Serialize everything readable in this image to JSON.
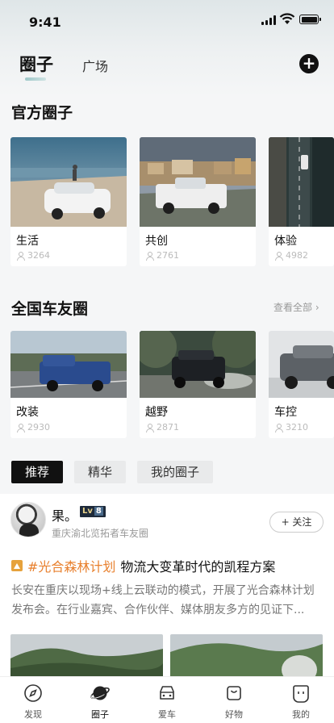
{
  "status": {
    "time": "9:41"
  },
  "tabs": {
    "active": "圈子",
    "other": "广场",
    "add": "+"
  },
  "official": {
    "title": "官方圈子",
    "cards": [
      {
        "name": "生活",
        "count": "3264"
      },
      {
        "name": "共创",
        "count": "2761"
      },
      {
        "name": "体验",
        "count": "4982"
      }
    ]
  },
  "national": {
    "title": "全国车友圈",
    "see_all": "查看全部 ›",
    "cards": [
      {
        "name": "改装",
        "count": "2930"
      },
      {
        "name": "越野",
        "count": "2871"
      },
      {
        "name": "车控",
        "count": "3210"
      }
    ]
  },
  "filters": [
    "推荐",
    "精华",
    "我的圈子"
  ],
  "post": {
    "user": "果。",
    "level_prefix": "Lv",
    "level": "8",
    "sub": "重庆渝北览拓者车友圈",
    "follow": "+ 关注",
    "topic": "#光合森林计划",
    "title": "物流大变革时代的凯程方案",
    "body": "长安在重庆以现场+线上云联动的模式，开展了光合森林计划发布会。在行业嘉宾、合作伙伴、媒体朋友多方的见证下..."
  },
  "tabbar": [
    {
      "label": "发现",
      "icon": "compass-icon"
    },
    {
      "label": "圈子",
      "icon": "planet-icon"
    },
    {
      "label": "爱车",
      "icon": "car-icon"
    },
    {
      "label": "好物",
      "icon": "shopping-bag-icon"
    },
    {
      "label": "我的",
      "icon": "smile-face-icon"
    }
  ]
}
